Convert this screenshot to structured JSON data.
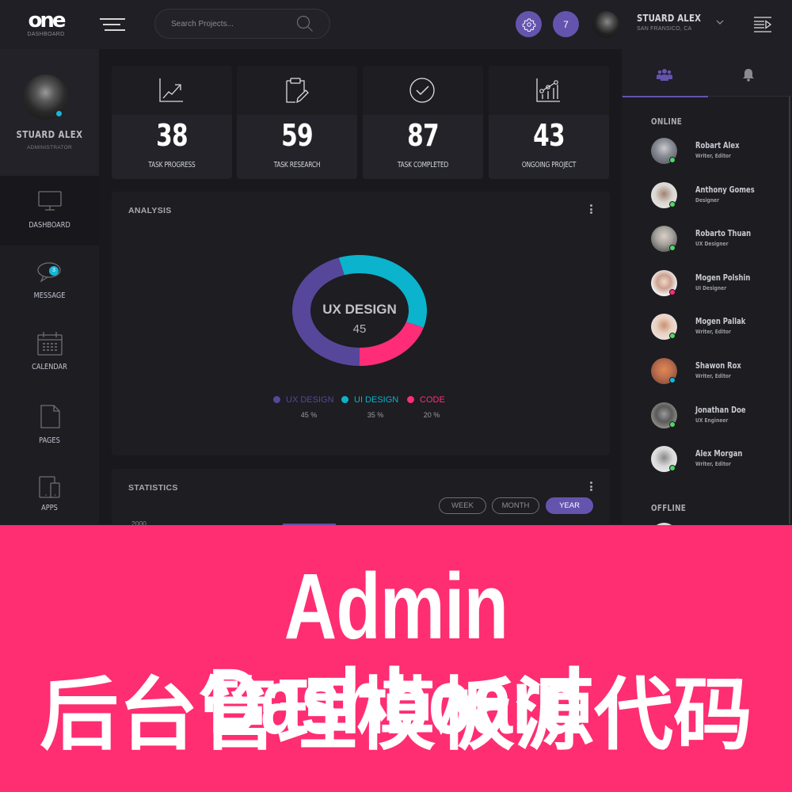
{
  "header": {
    "logo_text": "one",
    "logo_subtitle": "DASHBOARD",
    "search_placeholder": "Search Projects...",
    "notification_count": "7",
    "user_name": "STUARD ALEX",
    "user_location": "SAN FRANSICO, CA"
  },
  "sidebar": {
    "profile": {
      "name": "STUARD ALEX",
      "role": "ADMINISTRATOR"
    },
    "items": [
      {
        "label": "DASHBOARD",
        "icon": "monitor-icon",
        "active": true
      },
      {
        "label": "MESSAGE",
        "icon": "chat-bubble-icon",
        "badge": "3"
      },
      {
        "label": "CALENDAR",
        "icon": "calendar-icon"
      },
      {
        "label": "PAGES",
        "icon": "page-icon"
      },
      {
        "label": "APPS",
        "icon": "devices-icon"
      }
    ]
  },
  "stats": [
    {
      "value": "38",
      "label": "TASK PROGRESS",
      "icon": "trend-chart-icon"
    },
    {
      "value": "59",
      "label": "TASK RESEARCH",
      "icon": "clipboard-edit-icon"
    },
    {
      "value": "87",
      "label": "TASK COMPLETED",
      "icon": "check-circle-icon"
    },
    {
      "value": "43",
      "label": "ONGOING PROJECT",
      "icon": "bar-line-chart-icon"
    }
  ],
  "analysis": {
    "title": "ANALYSIS",
    "center_label": "UX DESIGN",
    "center_value": "45"
  },
  "chart_data": {
    "type": "pie",
    "title": "ANALYSIS",
    "categories": [
      "UX DESIGN",
      "UI DESIGN",
      "CODE"
    ],
    "values": [
      45,
      35,
      20
    ],
    "labels": [
      "45 %",
      "35 %",
      "20 %"
    ],
    "colors": [
      "#56479b",
      "#0bb3cc",
      "#ff2d78"
    ],
    "legend": "bottom"
  },
  "statistics": {
    "title": "STATISTICS",
    "ranges": [
      "WEEK",
      "MONTH",
      "YEAR"
    ],
    "active_range": "YEAR",
    "y_tick_top": "2000"
  },
  "right_panel": {
    "tabs": [
      {
        "icon": "users-icon",
        "active": true
      },
      {
        "icon": "bell-icon",
        "active": false
      }
    ],
    "online_label": "ONLINE",
    "offline_label": "OFFLINE",
    "contacts": [
      {
        "name": "Robart Alex",
        "role": "Writer, Editor",
        "status": "online"
      },
      {
        "name": "Anthony Gomes",
        "role": "Designer",
        "status": "online"
      },
      {
        "name": "Robarto Thuan",
        "role": "UX Designer",
        "status": "online"
      },
      {
        "name": "Mogen Polshin",
        "role": "UI Designer",
        "status": "busy"
      },
      {
        "name": "Mogen Pallak",
        "role": "Writer, Editor",
        "status": "online"
      },
      {
        "name": "Shawon Rox",
        "role": "Writer, Editor",
        "status": "away"
      },
      {
        "name": "Jonathan Doe",
        "role": "UX Engineer",
        "status": "online"
      },
      {
        "name": "Alex Morgan",
        "role": "Writer, Editor",
        "status": "online"
      }
    ],
    "status_colors": {
      "online": "#4cd964",
      "busy": "#ff2d78",
      "away": "#15b7d8"
    }
  },
  "banner": {
    "title_en": "Admin Dashboard",
    "title_cn": "后台管理模板源代码",
    "background": "#ff2d72"
  },
  "colors": {
    "accent": "#6554ae",
    "cyan": "#15b7d8",
    "pink": "#ff2d78"
  }
}
